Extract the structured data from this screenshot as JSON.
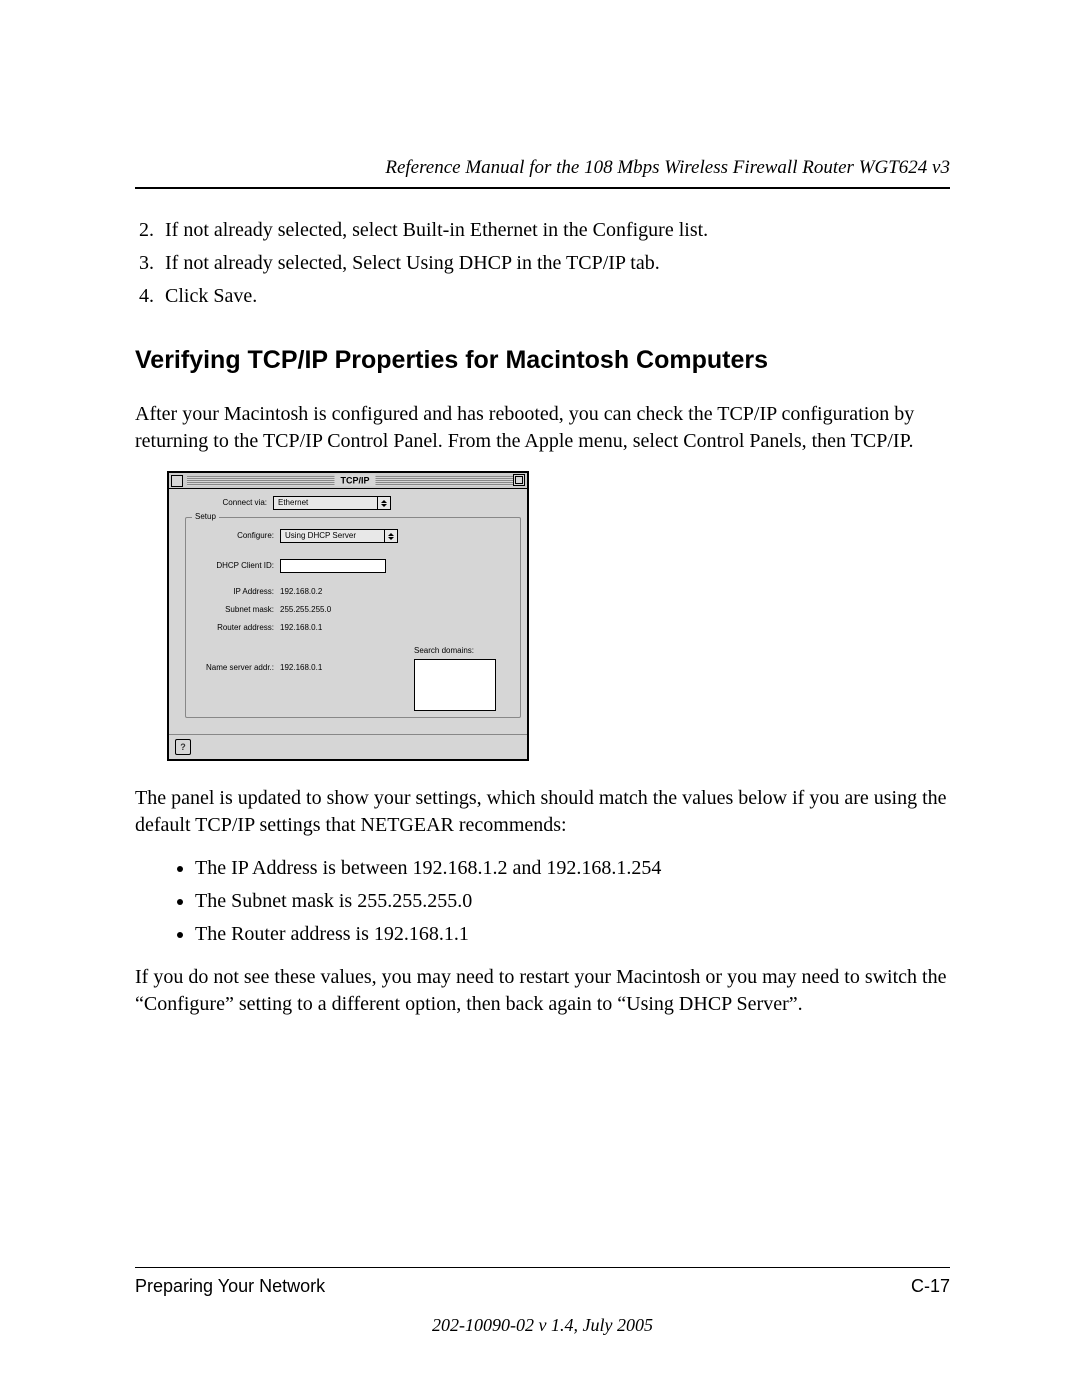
{
  "header": {
    "title": "Reference Manual for the 108 Mbps Wireless Firewall Router WGT624 v3"
  },
  "steps": {
    "start": "2",
    "items": [
      "If not already selected, select Built-in Ethernet in the Configure list.",
      "If not already selected, Select Using DHCP in the TCP/IP tab.",
      "Click Save."
    ]
  },
  "section_heading": "Verifying TCP/IP Properties for Macintosh Computers",
  "para1": "After your Macintosh is configured and has rebooted, you can check the TCP/IP configuration by returning to the TCP/IP Control Panel. From the Apple menu, select Control Panels, then TCP/IP.",
  "panel": {
    "title": "TCP/IP",
    "connect_via_label": "Connect via:",
    "connect_via_value": "Ethernet",
    "setup_legend": "Setup",
    "configure_label": "Configure:",
    "configure_value": "Using DHCP Server",
    "dhcp_client_id_label": "DHCP Client ID:",
    "dhcp_client_id_value": "",
    "ip_address_label": "IP Address:",
    "ip_address_value": "192.168.0.2",
    "subnet_mask_label": "Subnet mask:",
    "subnet_mask_value": "255.255.255.0",
    "router_address_label": "Router address:",
    "router_address_value": "192.168.0.1",
    "name_server_label": "Name server addr.:",
    "name_server_value": "192.168.0.1",
    "search_domains_label": "Search domains:",
    "help_symbol": "?"
  },
  "para2": "The panel is updated to show your settings, which should match the values below if you are using the default TCP/IP settings that NETGEAR recommends:",
  "bullets": [
    "The IP Address is between 192.168.1.2 and 192.168.1.254",
    "The Subnet mask is 255.255.255.0",
    "The Router address is 192.168.1.1"
  ],
  "para3": "If you do not see these values, you may need to restart your Macintosh or you may need to switch the “Configure” setting to a different option, then back again to “Using DHCP Server”.",
  "footer": {
    "left": "Preparing Your Network",
    "right": "C-17",
    "docline": "202-10090-02 v 1.4, July 2005"
  }
}
